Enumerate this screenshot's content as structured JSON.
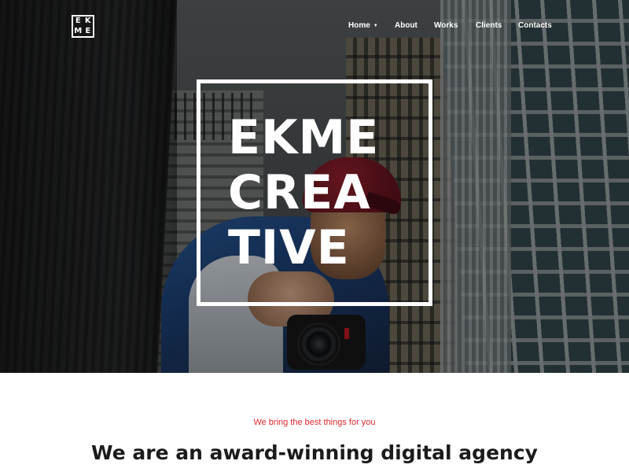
{
  "brand": {
    "logo_letters": [
      "E",
      "K",
      "M",
      "E"
    ]
  },
  "nav": {
    "items": [
      {
        "label": "Home",
        "has_dropdown": true
      },
      {
        "label": "About"
      },
      {
        "label": "Works"
      },
      {
        "label": "Clients"
      },
      {
        "label": "Contacts"
      }
    ]
  },
  "hero": {
    "title_lines": [
      "EKME",
      "CREA",
      "TIVE"
    ]
  },
  "intro": {
    "tagline": "We bring the best things for you",
    "headline": "We are an award-winning digital agency"
  },
  "colors": {
    "accent": "#e0262c",
    "text_dark": "#1b1b1b",
    "white": "#ffffff"
  }
}
